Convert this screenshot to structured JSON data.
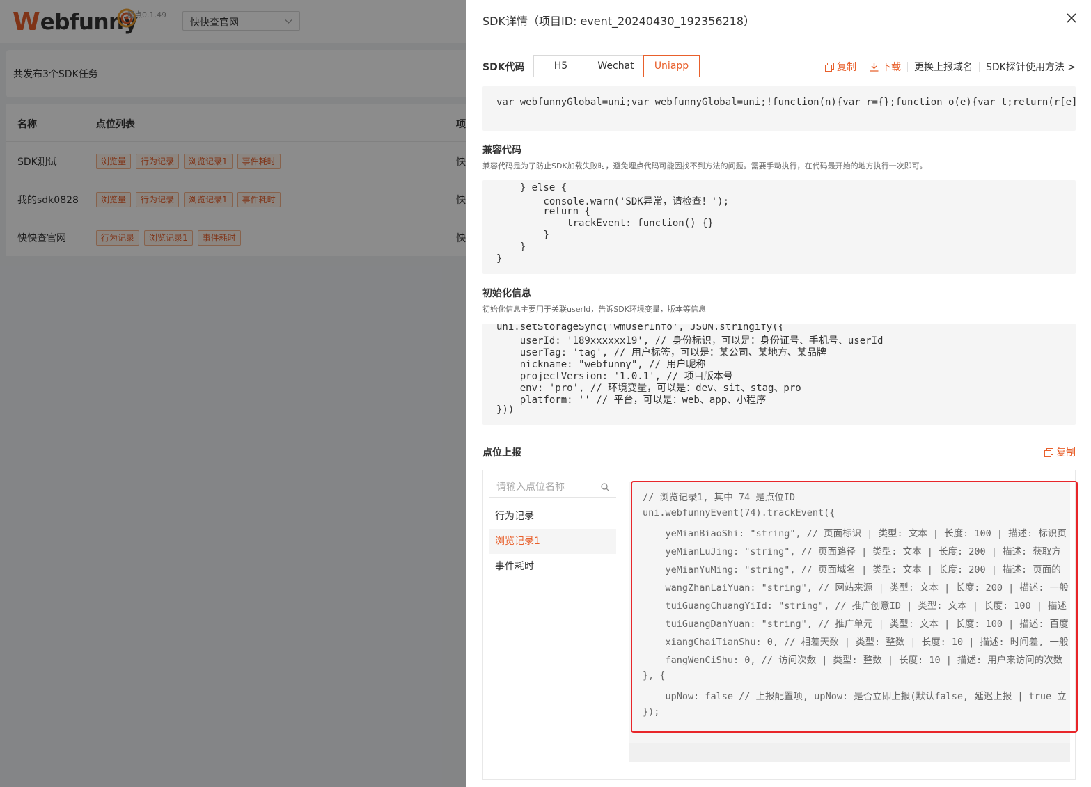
{
  "app": {
    "logo_first": "W",
    "logo_rest": "ebfunny",
    "version": "埋点0.1.49",
    "project_select": "快快查官网"
  },
  "summary": {
    "text": "共发布3个SDK任务"
  },
  "table": {
    "headers": [
      "名称",
      "点位列表",
      "项"
    ],
    "rows": [
      {
        "name": "SDK测试",
        "tags": [
          "浏览量",
          "行为记录",
          "浏览记录1",
          "事件耗时"
        ],
        "proj": "快"
      },
      {
        "name": "我的sdk0828",
        "tags": [
          "浏览量",
          "行为记录",
          "浏览记录1",
          "事件耗时"
        ],
        "proj": "快"
      },
      {
        "name": "快快查官网",
        "tags": [
          "行为记录",
          "浏览记录1",
          "事件耗时"
        ],
        "proj": "快"
      }
    ]
  },
  "drawer": {
    "title": "SDK详情（项目ID: event_20240430_192356218）",
    "sdk_label": "SDK代码",
    "tabs": [
      "H5",
      "Wechat",
      "Uniapp"
    ],
    "active_tab": "Uniapp",
    "actions": {
      "copy": "复制",
      "download": "下载",
      "change_domain": "更换上报域名",
      "probe_usage": "SDK探针使用方法 >"
    },
    "sdk_code": "var webfunnyGlobal=uni;var webfunnyGlobal=uni;!function(n){var r={};function o(e){var t;return(r[e]",
    "compat": {
      "title": "兼容代码",
      "desc": "兼容代码是为了防止SDK加载失败时，避免埋点代码可能因找不到方法的问题。需要手动执行，在代码最开始的地方执行一次即可。",
      "lines": [
        "    } else {",
        "        console.warn('SDK异常，请检查！');",
        "        return {",
        "            trackEvent: function() {}",
        "        }",
        "    }",
        "}"
      ]
    },
    "init": {
      "title": "初始化信息",
      "desc": "初始化信息主要用于关联userId，告诉SDK环境变量，版本等信息",
      "lines": [
        "uni.setStorageSync('wmUserInfo', JSON.stringify({",
        "    userId: '189xxxxxx19', // 身份标识，可以是：身份证号、手机号、userId",
        "    userTag: 'tag', // 用户标签，可以是：某公司、某地方、某品牌",
        "    nickname: \"webfunny\", // 用户昵称",
        "    projectVersion: '1.0.1', // 项目版本号",
        "    env: 'pro', // 环境变量，可以是：dev、sit、stag、pro",
        "    platform: '' // 平台，可以是：web、app、小程序",
        "}))"
      ]
    },
    "tracking": {
      "title": "点位上报",
      "copy": "复制",
      "search_placeholder": "请输入点位名称",
      "events": [
        "行为记录",
        "浏览记录1",
        "事件耗时"
      ],
      "active_event": "浏览记录1",
      "code_lines": [
        "// 浏览记录1, 其中 74 是点位ID",
        "uni.webfunnyEvent(74).trackEvent({",
        "    yeMianBiaoShi: \"string\", // 页面标识 | 类型: 文本 | 长度: 100 | 描述: 标识页",
        "    yeMianLuJing: \"string\", // 页面路径 | 类型: 文本 | 长度: 200 | 描述: 获取方",
        "    yeMianYuMing: \"string\", // 页面域名 | 类型: 文本 | 长度: 200 | 描述: 页面的",
        "    wangZhanLaiYuan: \"string\", // 网站来源 | 类型: 文本 | 长度: 200 | 描述: 一般",
        "    tuiGuangChuangYiId: \"string\", // 推广创意ID | 类型: 文本 | 长度: 100 | 描述",
        "    tuiGuangDanYuan: \"string\", // 推广单元 | 类型: 文本 | 长度: 100 | 描述: 百度",
        "    xiangChaiTianShu: 0, // 相差天数 | 类型: 整数 | 长度: 10 | 描述: 时间差, 一般",
        "    fangWenCiShu: 0, // 访问次数 | 类型: 整数 | 长度: 10 | 描述: 用户来访问的次数",
        "}, {",
        "    upNow: false // 上报配置项, upNow: 是否立即上报(默认false, 延迟上报 | true 立",
        "});"
      ]
    }
  },
  "colors": {
    "accent": "#e8602c",
    "highlight": "#e8262a",
    "mask": "rgba(0,0,0,0.45)"
  }
}
